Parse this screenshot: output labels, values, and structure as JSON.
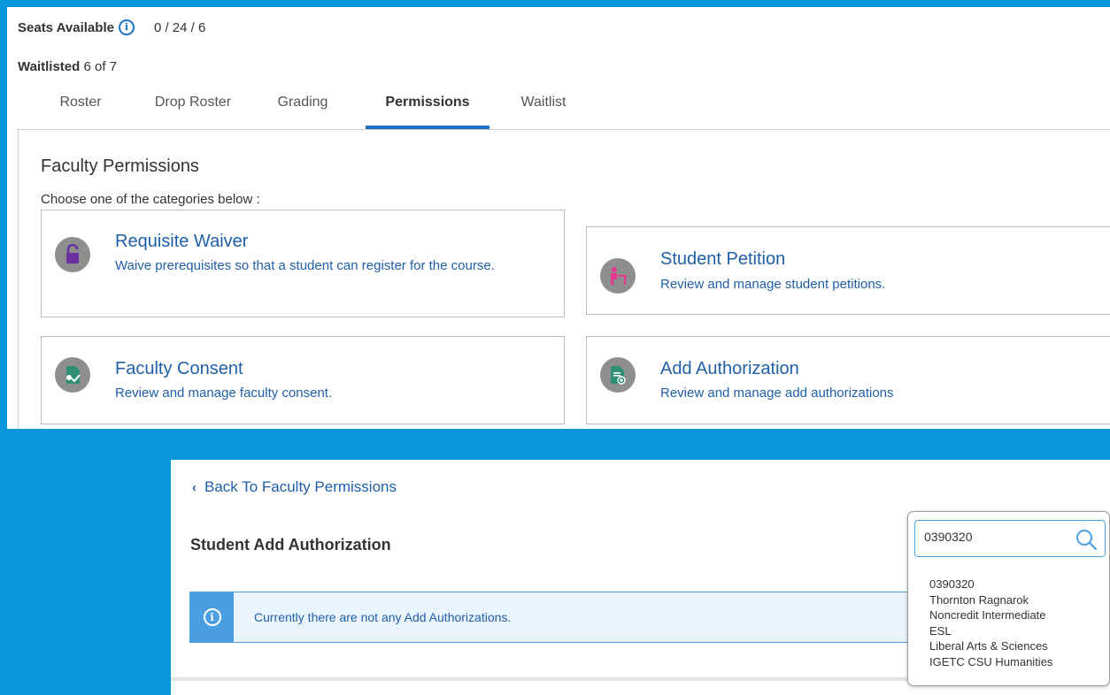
{
  "header": {
    "seats_label": "Seats Available",
    "seats_value": "0 / 24 / 6",
    "waitlisted_label": "Waitlisted",
    "waitlisted_value": "6 of 7"
  },
  "tabs": [
    {
      "label": "Roster"
    },
    {
      "label": "Drop Roster"
    },
    {
      "label": "Grading"
    },
    {
      "label": "Permissions",
      "active": true
    },
    {
      "label": "Waitlist"
    }
  ],
  "faculty_permissions": {
    "title": "Faculty Permissions",
    "subtitle": "Choose one of the categories below :",
    "cards": [
      {
        "icon": "unlock-icon",
        "title": "Requisite Waiver",
        "desc": "Waive prerequisites so that a student can register for the course."
      },
      {
        "icon": "student-desk-icon",
        "title": "Student Petition",
        "desc": "Review and manage student petitions."
      },
      {
        "icon": "document-check-icon",
        "title": "Faculty Consent",
        "desc": "Review and manage faculty consent."
      },
      {
        "icon": "document-add-icon",
        "title": "Add Authorization",
        "desc": "Review and manage add authorizations"
      }
    ]
  },
  "add_authorization": {
    "back_label": "Back To Faculty Permissions",
    "title": "Student Add Authorization",
    "alert_message": "Currently there are not any Add Authorizations."
  },
  "search": {
    "value": "0390320",
    "result_lines": [
      "0390320",
      "Thornton Ragnarok",
      "Noncredit Intermediate",
      "ESL",
      "Liberal Arts & Sciences",
      "IGETC CSU Humanities"
    ]
  },
  "colors": {
    "background": "#0b96d9",
    "link": "#1f5fa8",
    "accent": "#1a73c7",
    "info": "#4a9fe0",
    "icon_purple": "#6b2fa0",
    "icon_pink": "#e7388f",
    "icon_green": "#2f8f74"
  }
}
